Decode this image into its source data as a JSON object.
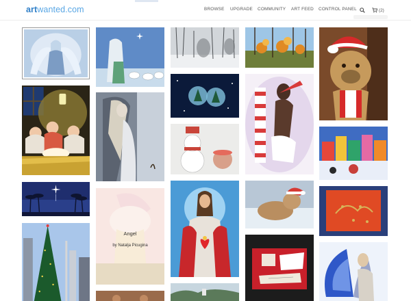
{
  "header": {
    "logo_part1": "art",
    "logo_part2": "wanted.com",
    "nav": [
      "BROWSE",
      "UPGRADE",
      "COMMUNITY",
      "ART FEED",
      "CONTROL PANEL"
    ],
    "search_icon": "search-icon",
    "cart_icon": "cart-icon",
    "cart_count": "(2)"
  },
  "gallery": {
    "hover_title": "Angel",
    "hover_artist": "by Natalja Picugina"
  },
  "colors": {
    "logo_dark": "#2f7fc8",
    "logo_light": "#58a6e4",
    "nav_text": "#555555"
  }
}
